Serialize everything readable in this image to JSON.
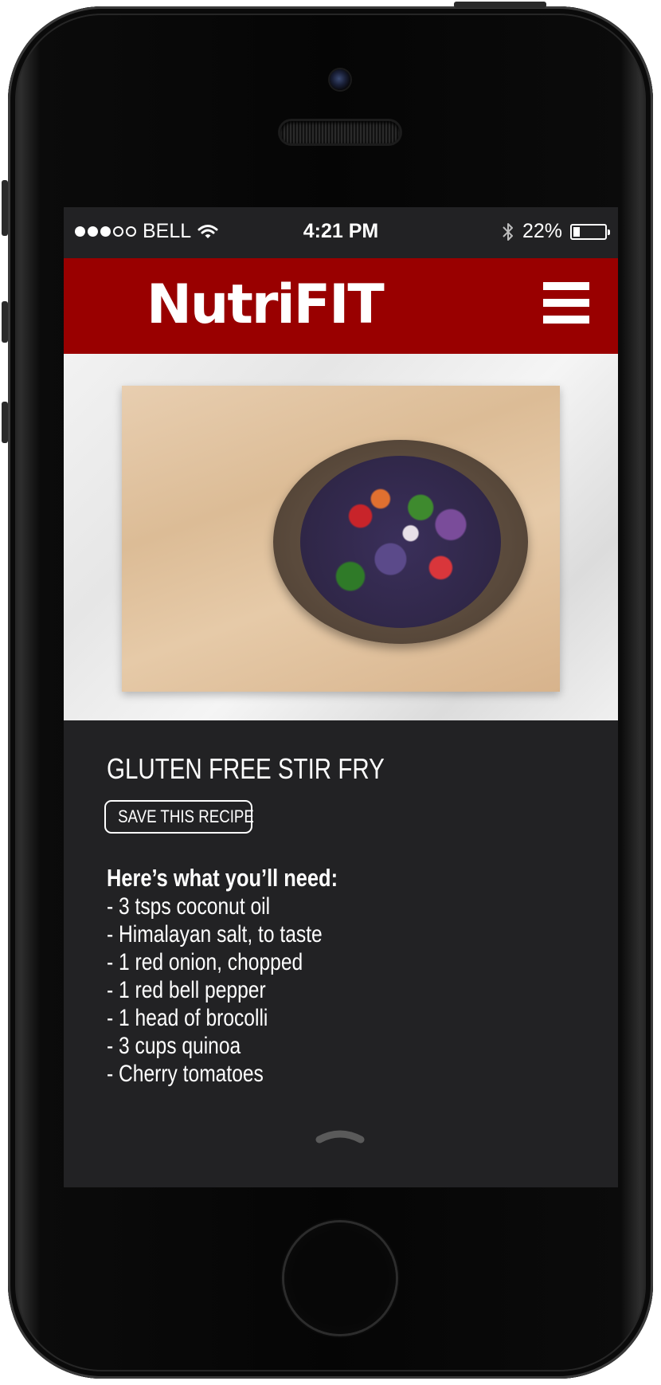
{
  "status_bar": {
    "carrier": "BELL",
    "time": "4:21 PM",
    "battery": "22%",
    "battery_level": 0.22,
    "signal_bars_filled": 3,
    "signal_bars_total": 5
  },
  "header": {
    "logo": "NutriFIT",
    "menu_icon": "hamburger-menu-icon",
    "background": "#990000"
  },
  "hero": {
    "image": "stir-fry-bowl-on-cutting-board"
  },
  "recipe": {
    "title": "GLUTEN FREE STIR FRY",
    "save_label": "SAVE THIS RECIPE",
    "needs_heading": "Here’s what you’ll need:",
    "ingredients": [
      "- 3 tsps coconut oil",
      "- Himalayan salt, to taste",
      "- 1  red onion, chopped",
      "- 1 red bell pepper",
      "- 1 head of brocolli",
      "- 3 cups quinoa",
      "- Cherry tomatoes"
    ]
  },
  "footer": {
    "scroll_icon": "chevron-up-icon"
  }
}
